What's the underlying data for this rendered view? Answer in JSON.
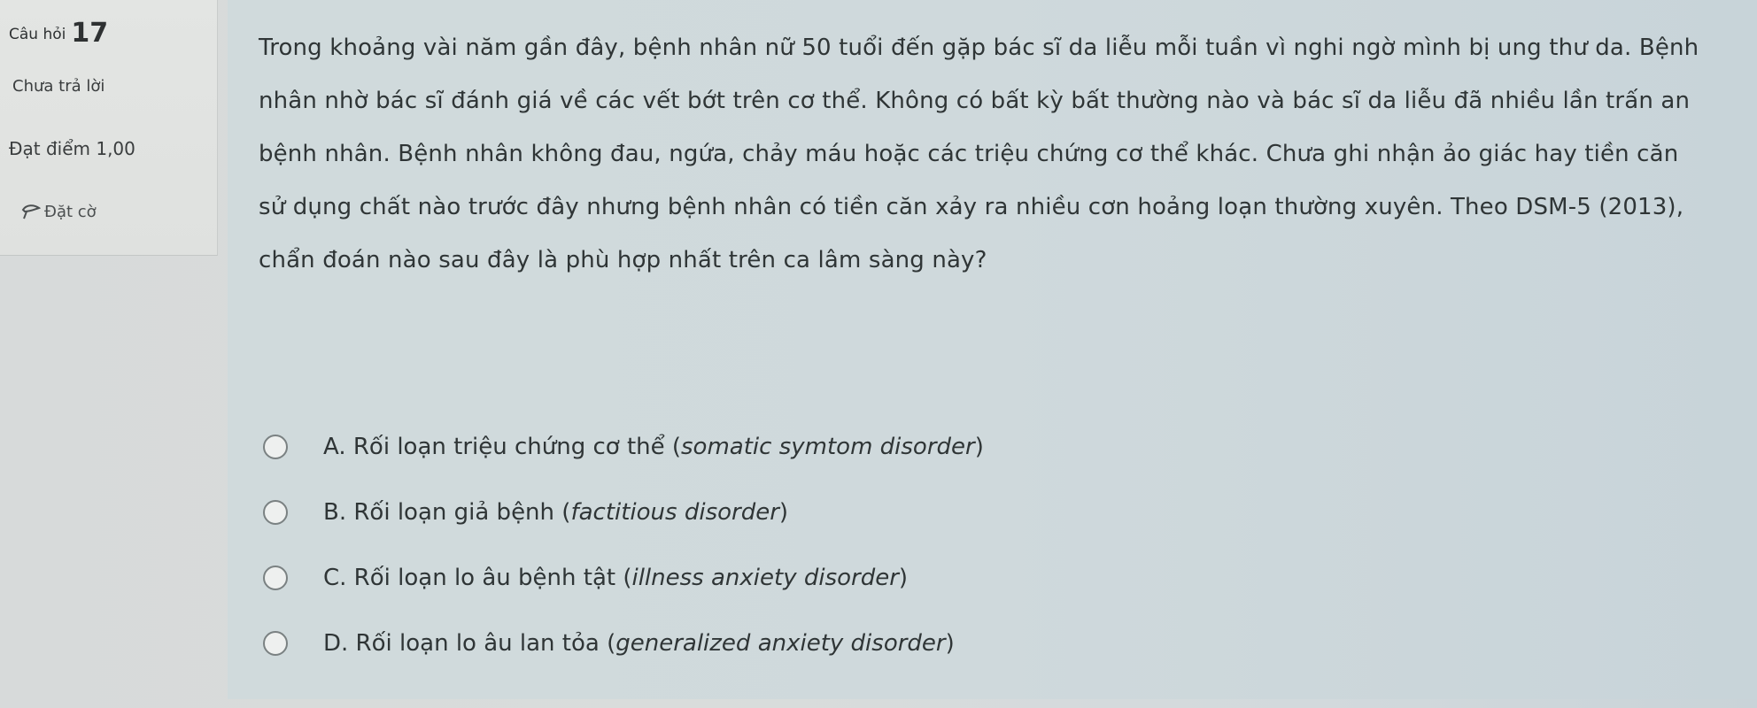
{
  "info": {
    "question_label": "Câu hỏi",
    "question_number": "17",
    "state": "Chưa trả lời",
    "grade": "Đạt điểm 1,00",
    "flag_label": "Đặt cờ"
  },
  "question": {
    "text": "Trong khoảng vài năm gần đây, bệnh nhân nữ 50 tuổi đến gặp bác sĩ da liễu mỗi tuần vì nghi ngờ mình bị ung thư da. Bệnh nhân nhờ bác sĩ đánh giá về các vết bớt trên cơ thể. Không có bất kỳ bất thường nào và bác sĩ da liễu đã nhiều lần trấn an bệnh nhân. Bệnh nhân không đau, ngứa, chảy máu hoặc các triệu chứng cơ thể khác. Chưa ghi nhận ảo giác hay tiền căn sử dụng chất nào trước đây nhưng bệnh nhân có tiền căn xảy ra nhiều cơn hoảng loạn thường xuyên. Theo DSM-5 (2013), chẩn đoán nào sau đây là phù hợp nhất trên ca lâm sàng này?"
  },
  "answers": [
    {
      "prefix": "A. Rối loạn triệu chứng cơ thể (",
      "english": "somatic symtom disorder",
      "suffix": ")"
    },
    {
      "prefix": "B. Rối loạn giả bệnh (",
      "english": "factitious disorder",
      "suffix": ")"
    },
    {
      "prefix": "C. Rối loạn lo âu bệnh tật (",
      "english": "illness anxiety disorder",
      "suffix": ")"
    },
    {
      "prefix": "D. Rối loạn lo âu lan tỏa (",
      "english": "generalized anxiety disorder",
      "suffix": ")"
    }
  ]
}
